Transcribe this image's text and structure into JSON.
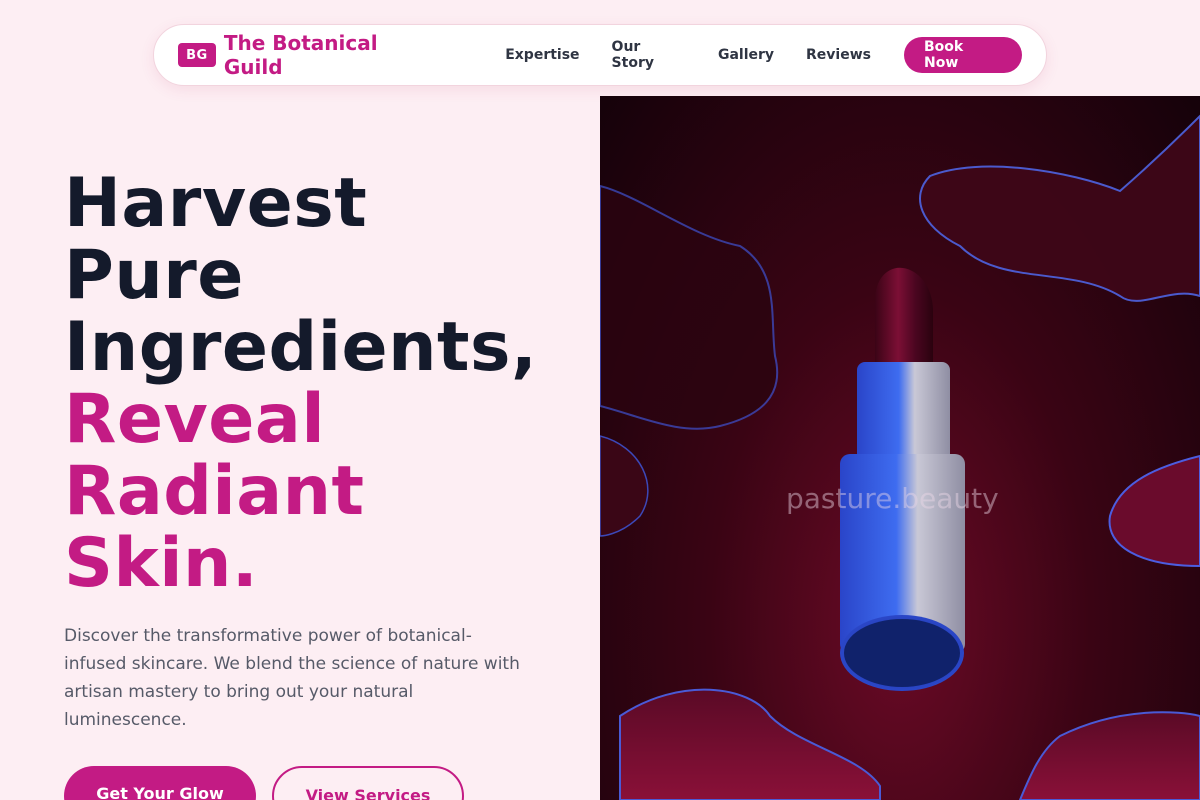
{
  "brand": {
    "badge": "BG",
    "name": "The Botanical Guild"
  },
  "nav": {
    "links": [
      "Expertise",
      "Our Story",
      "Gallery",
      "Reviews"
    ],
    "cta": "Book Now"
  },
  "hero": {
    "title_lines": [
      "Harvest",
      "Pure",
      "Ingredients,"
    ],
    "accent_lines": [
      "Reveal",
      "Radiant",
      "Skin."
    ],
    "description": "Discover the transformative power of botanical-infused skincare. We blend the science of nature with artisan mastery to bring out your natural luminescence.",
    "primary_cta": "Get Your Glow",
    "secondary_cta": "View Services"
  },
  "image": {
    "watermark": "pasture.beauty",
    "subject": "lipstick-icon"
  },
  "colors": {
    "accent": "#c31b84",
    "background": "#fdeef3",
    "heading": "#141a2b",
    "body_text": "#565a68"
  }
}
